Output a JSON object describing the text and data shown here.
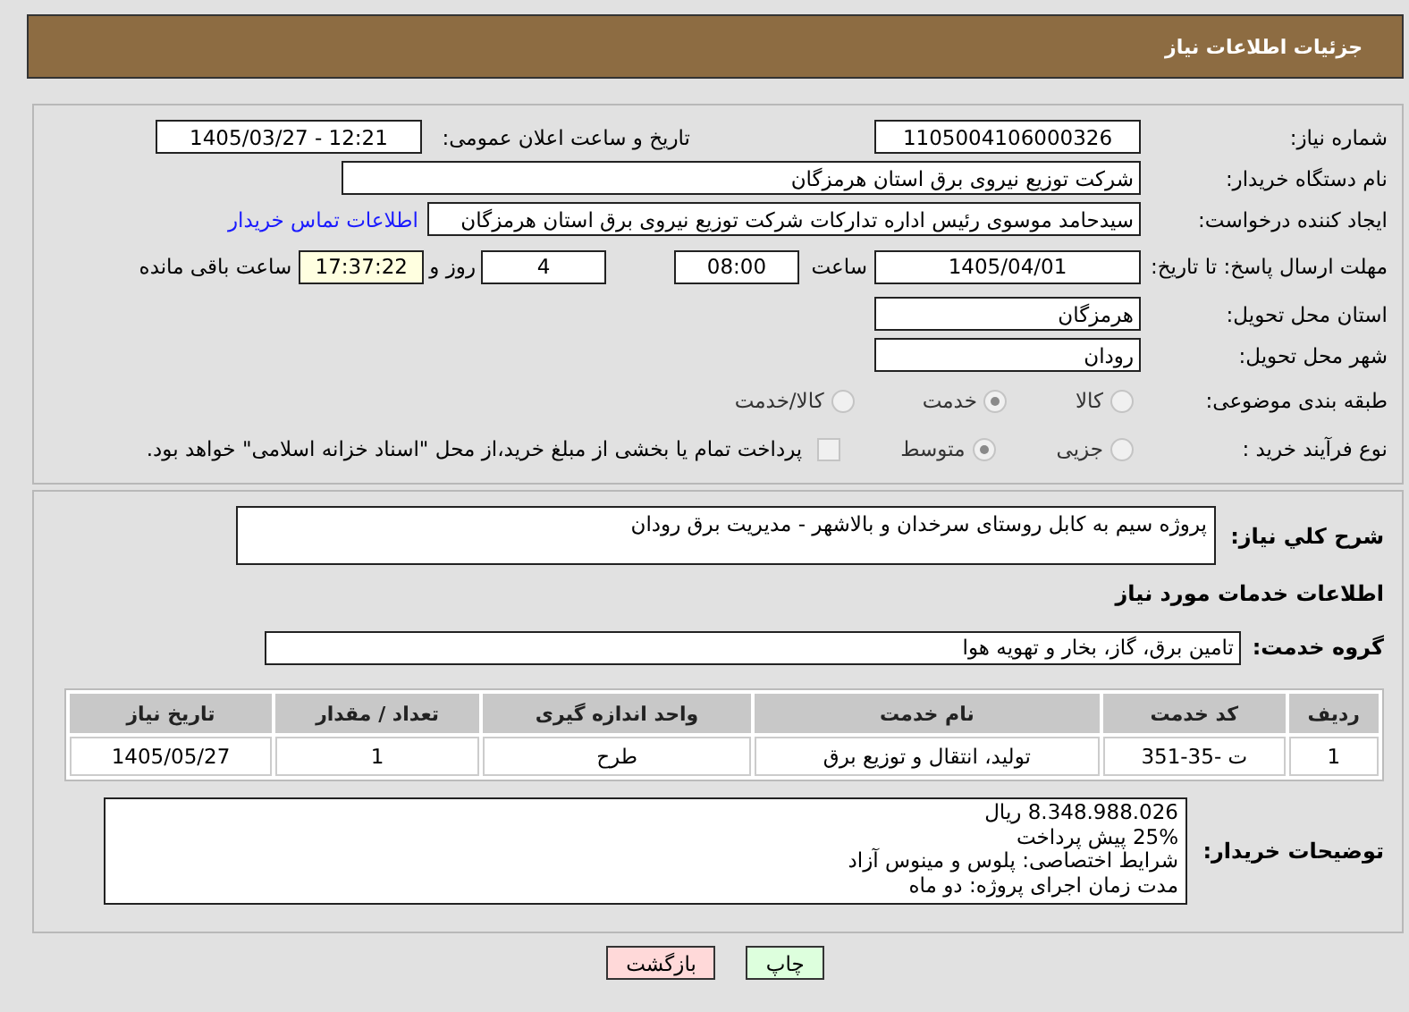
{
  "header": {
    "title": "جزئیات اطلاعات نیاز"
  },
  "need_number": {
    "label": "شماره نیاز:",
    "value": "1105004106000326"
  },
  "announce": {
    "label": "تاریخ و ساعت اعلان عمومی:",
    "value": "1405/03/27 - 12:21"
  },
  "buyer_org": {
    "label": "نام دستگاه خریدار:",
    "value": "شرکت توزیع نیروی برق استان هرمزگان"
  },
  "requester": {
    "label": "ایجاد کننده درخواست:",
    "value": "سیدحامد موسوی رئیس اداره تدارکات شرکت توزیع نیروی برق استان هرمزگان",
    "link": "اطلاعات تماس خریدار"
  },
  "deadline": {
    "label": "مهلت ارسال پاسخ: تا تاریخ:",
    "date": "1405/04/01",
    "time_label": "ساعت",
    "time": "08:00",
    "days": "4",
    "days_label": "روز و",
    "remaining": "17:37:22",
    "remaining_label": "ساعت باقی مانده"
  },
  "province": {
    "label": "استان محل تحویل:",
    "value": "هرمزگان"
  },
  "city": {
    "label": "شهر محل تحویل:",
    "value": "رودان"
  },
  "category": {
    "label": "طبقه بندی موضوعی:",
    "options": [
      {
        "label": "کالا",
        "selected": false
      },
      {
        "label": "خدمت",
        "selected": true
      },
      {
        "label": "کالا/خدمت",
        "selected": false
      }
    ]
  },
  "process": {
    "label": "نوع فرآیند خرید :",
    "options": [
      {
        "label": "جزیی",
        "selected": false
      },
      {
        "label": "متوسط",
        "selected": true
      }
    ],
    "payment_note": {
      "text": "پرداخت تمام یا بخشی از مبلغ خرید،از محل \"اسناد خزانه اسلامی\" خواهد بود.",
      "checked": false
    }
  },
  "summary": {
    "label": "شرح کلي نياز:",
    "value": "پروژه سیم به کابل روستای سرخدان و بالاشهر - مدیریت برق رودان"
  },
  "services_heading": "اطلاعات خدمات مورد نیاز",
  "service_group": {
    "label": "گروه خدمت:",
    "value": "تامین برق، گاز، بخار و تهویه هوا"
  },
  "table": {
    "columns": [
      "ردیف",
      "کد خدمت",
      "نام خدمت",
      "واحد اندازه گیری",
      "تعداد / مقدار",
      "تاریخ نیاز"
    ],
    "rows": [
      [
        "1",
        "ت -35-351",
        "تولید، انتقال و توزیع برق",
        "طرح",
        "1",
        "1405/05/27"
      ]
    ]
  },
  "buyer_notes": {
    "label": "توضیحات خریدار:",
    "lines": [
      "8.348.988.026 ریال",
      "25% پیش پرداخت",
      "شرایط اختصاصی: پلوس و مینوس آزاد",
      "مدت زمان اجرای پروژه: دو ماه"
    ]
  },
  "buttons": [
    {
      "label": "چاپ",
      "kind": "print"
    },
    {
      "label": "بازگشت",
      "kind": "back"
    }
  ]
}
